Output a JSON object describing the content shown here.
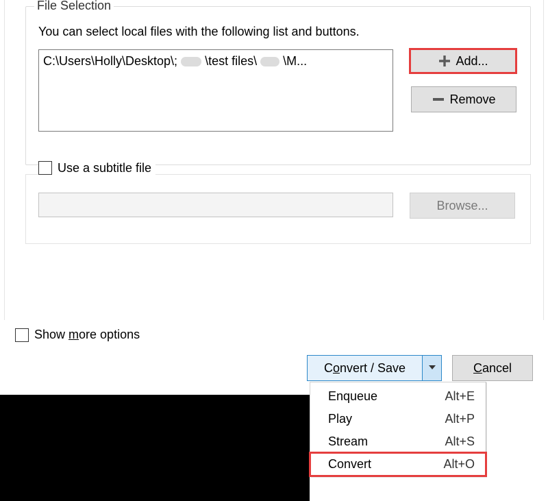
{
  "file_selection": {
    "legend": "File Selection",
    "help": "You can select local files with the following list and buttons.",
    "file_path_display": "C:\\Users\\Holly\\Desktop\\; \\test files\\ \\M...",
    "file_path_prefix": "C:\\Users\\Holly\\Desktop\\;",
    "file_path_mid": "\\test files\\",
    "file_path_suffix": "\\M...",
    "add_label": "Add...",
    "remove_label": "Remove"
  },
  "subtitle": {
    "checkbox_label": "Use a subtitle file",
    "input_value": "",
    "browse_label": "Browse..."
  },
  "show_more": {
    "label_prefix": "Show ",
    "label_underlined": "m",
    "label_suffix": "ore options"
  },
  "buttons": {
    "convert_save_prefix": "C",
    "convert_save_u": "o",
    "convert_save_suffix": "nvert / Save",
    "cancel_prefix": "",
    "cancel_u": "C",
    "cancel_suffix": "ancel"
  },
  "menu": {
    "items": [
      {
        "label": "Enqueue",
        "shortcut": "Alt+E"
      },
      {
        "label": "Play",
        "shortcut": "Alt+P"
      },
      {
        "label": "Stream",
        "shortcut": "Alt+S"
      },
      {
        "label": "Convert",
        "shortcut": "Alt+O"
      }
    ]
  }
}
